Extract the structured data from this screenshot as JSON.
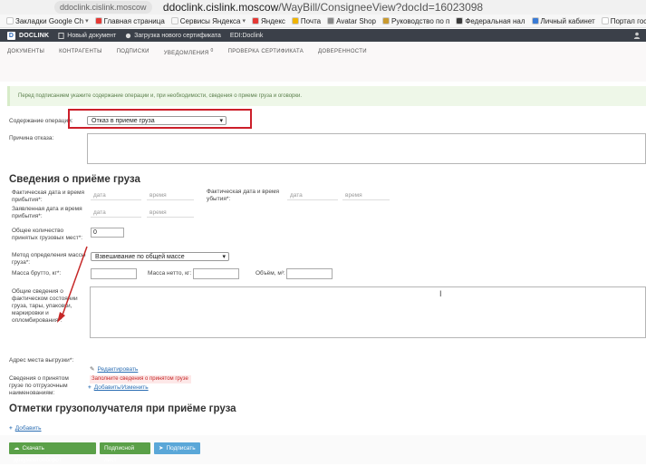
{
  "browser": {
    "tab_chip": "ddoclink.cislink.moscow",
    "url_domain": "ddoclink.cislink.moscow",
    "url_path": "/WayBill/ConsigneeView?docId=16023098"
  },
  "bookmarks": [
    {
      "label": "Закладки Google Ch",
      "color": "#ffffff",
      "chev": true
    },
    {
      "label": "Главная страница",
      "color": "#e53935",
      "chev": false
    },
    {
      "label": "Сервисы Яндекса",
      "color": "#f7f7f7",
      "chev": true
    },
    {
      "label": "Яндекс",
      "color": "#e53935",
      "chev": false
    },
    {
      "label": "Почта",
      "color": "#f0b400",
      "chev": false
    },
    {
      "label": "Avatar Shop",
      "color": "#888888",
      "chev": false
    },
    {
      "label": "Руководство по п",
      "color": "#c99a2e",
      "chev": false
    },
    {
      "label": "Федеральная нал",
      "color": "#3b3b3b",
      "chev": false
    },
    {
      "label": "Личный кабинет",
      "color": "#3a7bd5",
      "chev": false
    },
    {
      "label": "Портал государс",
      "color": "#ffffff",
      "chev": false
    },
    {
      "label": "AliExpress - инте",
      "color": "#e8542a",
      "chev": false
    }
  ],
  "appnav": {
    "logo": "DOCLINK",
    "logo_letter": "D",
    "items": [
      "Новый документ",
      "Загрузка нового сертификата",
      "EDI:Doclink"
    ]
  },
  "submenu": {
    "items": [
      "ДОКУМЕНТЫ",
      "КОНТРАГЕНТЫ",
      "ПОДПИСКИ",
      "УВЕДОМЛЕНИЯ",
      "ПРОВЕРКА СЕРТИФИКАТА",
      "ДОВЕРЕННОСТИ"
    ],
    "notif_count": "0"
  },
  "alert": "Перед подписанием укажите содержание операции и, при необходимости, сведения о приеме груза и оговорки.",
  "operation": {
    "label": "Содержание операции:",
    "value": "Отказ в приеме груза"
  },
  "refusal_reason": {
    "label": "Причина отказа:"
  },
  "cargo_section": {
    "title": "Сведения о приёме груза",
    "arrival_actual": "Фактическая дата и время прибытия*:",
    "departure_actual": "Фактическая дата и время убытия*:",
    "arrival_declared": "Заявленная дата и время прибытия*:",
    "date_ph": "дата",
    "time_ph": "время",
    "places_label": "Общее количество принятых грузовых мест*:",
    "places_value": "0",
    "mass_method_label": "Метод определения массы груза*:",
    "mass_method_value": "Взвешивание по общей массе",
    "gross_label": "Масса брутто, кг*:",
    "net_label": "Масса нетто, кг:",
    "volume_label": "Объём, м³:",
    "condition_label": "Общие сведения о фактическом состоянии груза, тары, упаковки, маркировки и опломбирования*:",
    "unload_label": "Адрес места выгрузки*:",
    "unload_link": "Редактировать",
    "accepted_label": "Сведения о принятом грузе по отгрузочным наименованиям:",
    "accepted_warn": "Заполните сведения о принятом грузе",
    "accepted_link": "Добавить/Изменить"
  },
  "marks_section": {
    "title": "Отметки грузополучателя при приёме груза",
    "add_link": "Добавить"
  },
  "footer": {
    "download": "Скачать документооборот",
    "sign_sheet": "Подписной лист",
    "sign": "Подписать"
  }
}
